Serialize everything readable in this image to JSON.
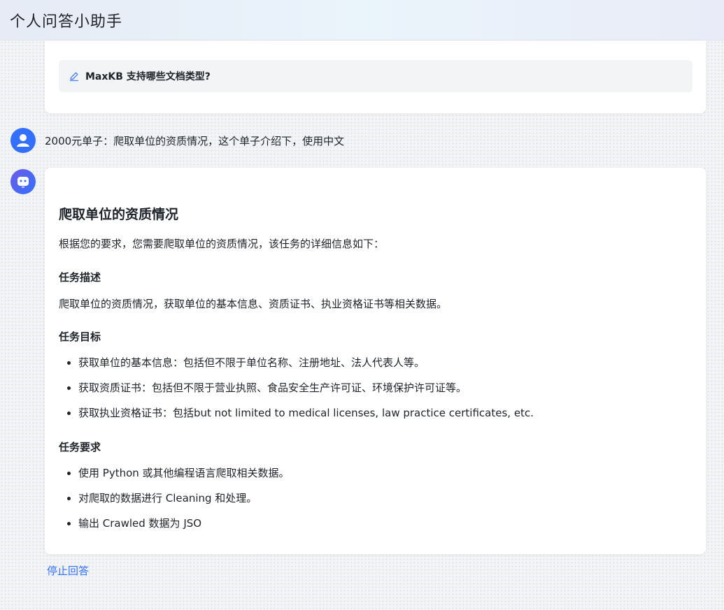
{
  "header": {
    "title": "个人问答小助手"
  },
  "previous_card": {
    "question": "MaxKB 支持哪些文档类型?"
  },
  "user_message": "2000元单子：爬取单位的资质情况，这个单子介绍下，使用中文",
  "answer": {
    "heading": "爬取单位的资质情况",
    "intro": "根据您的要求，您需要爬取单位的资质情况，该任务的详细信息如下：",
    "sections": [
      {
        "title": "任务描述",
        "text": "爬取单位的资质情况，获取单位的基本信息、资质证书、执业资格证书等相关数据。"
      },
      {
        "title": "任务目标",
        "items": [
          "获取单位的基本信息：包括但不限于单位名称、注册地址、法人代表人等。",
          "获取资质证书：包括但不限于营业执照、食品安全生产许可证、环境保护许可证等。",
          "获取执业资格证书：包括but not limited to medical licenses, law practice certificates, etc."
        ]
      },
      {
        "title": "任务要求",
        "items": [
          "使用 Python 或其他编程语言爬取相关数据。",
          "对爬取的数据进行 Cleaning 和处理。",
          "输出 Crawled 数据为 JSO"
        ]
      }
    ]
  },
  "stop_button": "停止回答",
  "colors": {
    "accent": "#3370ff",
    "text": "#1f2329"
  }
}
